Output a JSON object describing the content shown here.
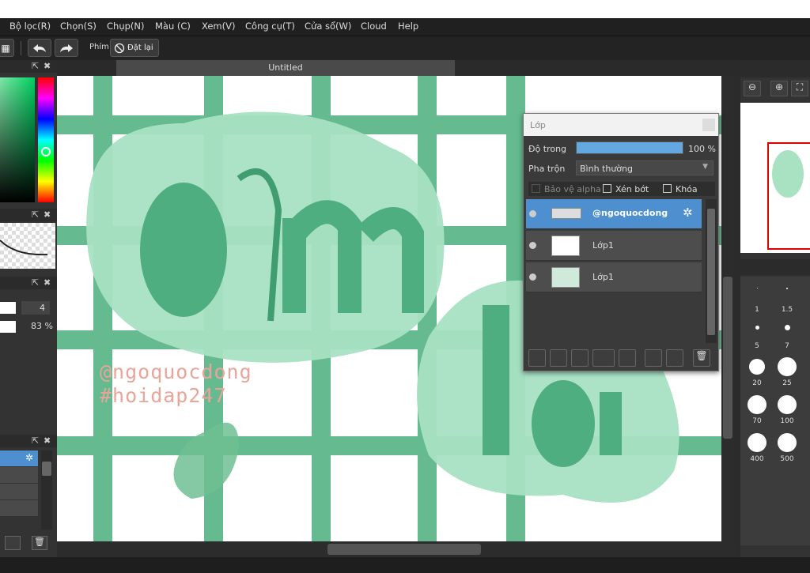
{
  "menu": {
    "items": [
      "Bộ lọc(R)",
      "Chọn(S)",
      "Chụp(N)",
      "Màu (C)",
      "Xem(V)",
      "Công cụ(T)",
      "Cửa sổ(W)",
      "Cloud",
      "Help"
    ]
  },
  "toolbar": {
    "shortcut_label": "Phím",
    "reset_label": "Đặt lại"
  },
  "document": {
    "tab_title": "Untitled"
  },
  "left_panel": {
    "size_value": "4",
    "opacity_value": "83 %"
  },
  "canvas_art": {
    "watermark_line1": "@ngoquocdong",
    "watermark_line2": "#hoidap247"
  },
  "layer_panel": {
    "title": "Lớp",
    "opacity_label": "Độ trong",
    "opacity_value": "100 %",
    "opacity_fraction": 1.0,
    "blend_label": "Pha trộn",
    "blend_value": "Bình thường",
    "protect_alpha_label": "Bảo vệ alpha",
    "clip_label": "Xén bớt",
    "lock_label": "Khóa",
    "layers": [
      {
        "name": "@ngoquocdong",
        "selected": true
      },
      {
        "name": "Lớp1",
        "selected": false
      },
      {
        "name": "Lớp1",
        "selected": false
      }
    ]
  },
  "brush_sizes": [
    "1",
    "1.5",
    "5",
    "7",
    "20",
    "25",
    "70",
    "100",
    "400",
    "500"
  ],
  "colors": {
    "accent": "#4e8fcf",
    "grid_green": "#55b383",
    "blob_green": "#a8e2c3",
    "letter_green": "#4fae7f",
    "watermark": "#e8a59a"
  }
}
